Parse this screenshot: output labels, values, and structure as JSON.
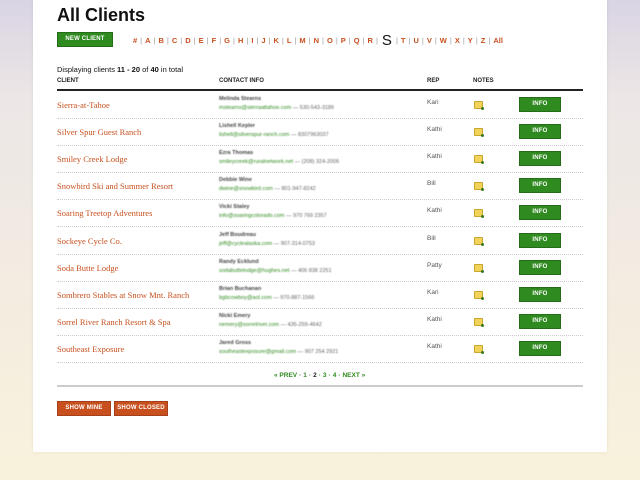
{
  "header": {
    "title": "All Clients",
    "new_client_label": "NEW CLIENT"
  },
  "alpha": {
    "items": [
      "#",
      "A",
      "B",
      "C",
      "D",
      "E",
      "F",
      "G",
      "H",
      "I",
      "J",
      "K",
      "L",
      "M",
      "N",
      "O",
      "P",
      "Q",
      "R",
      "S",
      "T",
      "U",
      "V",
      "W",
      "X",
      "Y",
      "Z",
      "All"
    ],
    "current": "S"
  },
  "display": {
    "prefix": "Displaying clients",
    "from": "11",
    "dash": "-",
    "to": "20",
    "of": "of",
    "total": "40",
    "suffix": "in total"
  },
  "table": {
    "columns": [
      "CLIENT",
      "CONTACT INFO",
      "REP",
      "NOTES"
    ],
    "info_label": "INFO",
    "rows": [
      {
        "client": "Sierra-at-Tahoe",
        "contact": "Melinda Stearns",
        "email": "mstearns@sierraattahoe.com",
        "phone": "530-543-3186",
        "rep": "Kari"
      },
      {
        "client": "Silver Spur Guest Ranch",
        "contact": "Lishell Kepler",
        "email": "lishell@silverspur-ranch.com",
        "phone": "8307963037",
        "rep": "Kathi"
      },
      {
        "client": "Smiley Creek Lodge",
        "contact": "Ezra Thomas",
        "email": "smileycreek@ruralnetwork.net",
        "phone": "(208) 324-2006",
        "rep": "Kathi"
      },
      {
        "client": "Snowbird Ski and Summer Resort",
        "contact": "Debbie Wine",
        "email": "dwine@snowbird.com",
        "phone": "801-947-8242",
        "rep": "Bill"
      },
      {
        "client": "Soaring Treetop Adventures",
        "contact": "Vicki Staley",
        "email": "info@soaringcolorado.com",
        "phone": "970 769 2357",
        "rep": "Kathi"
      },
      {
        "client": "Sockeye Cycle Co.",
        "contact": "Jeff Boudreau",
        "email": "jeff@cyclealaska.com",
        "phone": "907-314-0753",
        "rep": "Bill"
      },
      {
        "client": "Soda Butte Lodge",
        "contact": "Randy Ecklund",
        "email": "sodabuttelodge@hughes.net",
        "phone": "406 838 2251",
        "rep": "Patty"
      },
      {
        "client": "Sombrero Stables at Snow Mnt. Ranch",
        "contact": "Brian Buchanan",
        "email": "bgbcowboy@aol.com",
        "phone": "970-887-1566",
        "rep": "Kari"
      },
      {
        "client": "Sorrel River Ranch Resort & Spa",
        "contact": "Nicki Emery",
        "email": "nemery@sorrelriver.com",
        "phone": "435-259-4642",
        "rep": "Kathi"
      },
      {
        "client": "Southeast Exposure",
        "contact": "Jared Gross",
        "email": "southeastexposure@gmail.com",
        "phone": "907 254 2921",
        "rep": "Kathi"
      }
    ]
  },
  "pager": {
    "prev": "« PREV",
    "pages": [
      "1",
      "2",
      "3",
      "4"
    ],
    "current": "2",
    "next": "NEXT »"
  },
  "footer": {
    "show_mine": "SHOW MINE",
    "show_closed": "SHOW CLOSED"
  },
  "colors": {
    "accent_orange": "#c8501e",
    "accent_green": "#2f8a1f"
  }
}
